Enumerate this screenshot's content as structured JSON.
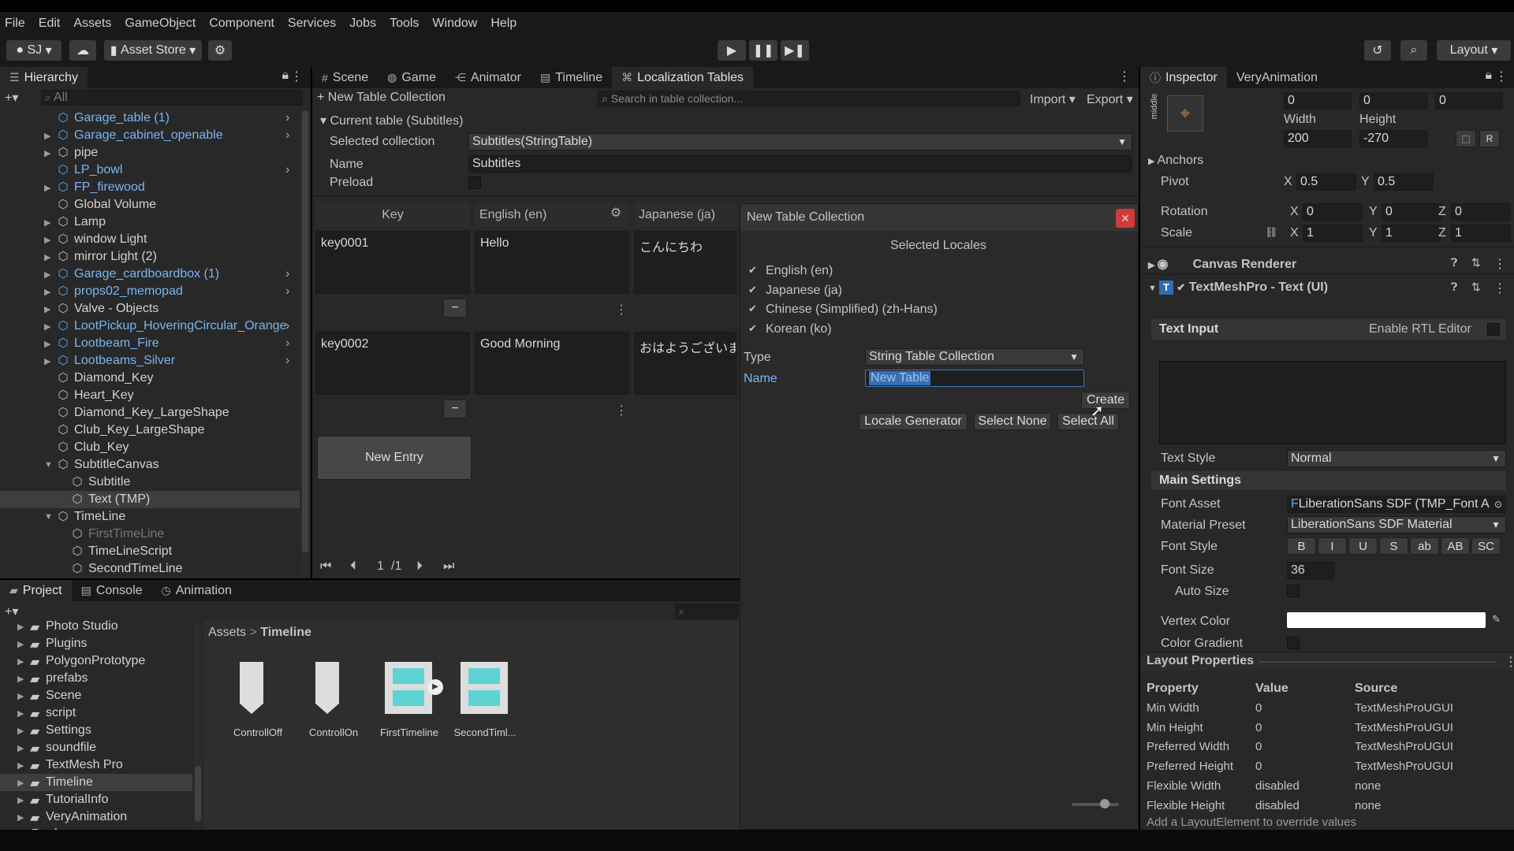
{
  "menu": [
    "File",
    "Edit",
    "Assets",
    "GameObject",
    "Component",
    "Services",
    "Jobs",
    "Tools",
    "Window",
    "Help"
  ],
  "toolbar": {
    "account": "SJ",
    "asset_store": "Asset Store",
    "layout": "Layout"
  },
  "hierarchy": {
    "tab": "Hierarchy",
    "search_placeholder": "All",
    "items": [
      {
        "label": "Garage_table (1)",
        "blue": true,
        "indent": 0,
        "exp": false,
        "chev": true
      },
      {
        "label": "Garage_cabinet_openable",
        "blue": true,
        "indent": 0,
        "exp": true,
        "chev": true
      },
      {
        "label": "pipe",
        "blue": false,
        "indent": 0,
        "exp": true,
        "chev": false
      },
      {
        "label": "LP_bowl",
        "blue": true,
        "indent": 0,
        "exp": false,
        "chev": true
      },
      {
        "label": "FP_firewood",
        "blue": true,
        "indent": 0,
        "exp": true,
        "chev": false
      },
      {
        "label": "Global Volume",
        "blue": false,
        "indent": 0,
        "exp": false,
        "chev": false
      },
      {
        "label": "Lamp",
        "blue": false,
        "indent": 0,
        "exp": true,
        "chev": false
      },
      {
        "label": "window Light",
        "blue": false,
        "indent": 0,
        "exp": true,
        "chev": false
      },
      {
        "label": "mirror Light (2)",
        "blue": false,
        "indent": 0,
        "exp": true,
        "chev": false
      },
      {
        "label": "Garage_cardboardbox (1)",
        "blue": true,
        "indent": 0,
        "exp": true,
        "chev": true
      },
      {
        "label": "props02_memopad",
        "blue": true,
        "indent": 0,
        "exp": true,
        "chev": true
      },
      {
        "label": "Valve - Objects",
        "blue": false,
        "indent": 0,
        "exp": true,
        "chev": false
      },
      {
        "label": "LootPickup_HoveringCircular_Orange",
        "blue": true,
        "indent": 0,
        "exp": true,
        "chev": true
      },
      {
        "label": "Lootbeam_Fire",
        "blue": true,
        "indent": 0,
        "exp": true,
        "chev": true
      },
      {
        "label": "Lootbeams_Silver",
        "blue": true,
        "indent": 0,
        "exp": true,
        "chev": true
      },
      {
        "label": "Diamond_Key",
        "blue": false,
        "indent": 0,
        "exp": false,
        "chev": false
      },
      {
        "label": "Heart_Key",
        "blue": false,
        "indent": 0,
        "exp": false,
        "chev": false
      },
      {
        "label": "Diamond_Key_LargeShape",
        "blue": false,
        "indent": 0,
        "exp": false,
        "chev": false
      },
      {
        "label": "Club_Key_LargeShape",
        "blue": false,
        "indent": 0,
        "exp": false,
        "chev": false
      },
      {
        "label": "Club_Key",
        "blue": false,
        "indent": 0,
        "exp": false,
        "chev": false
      },
      {
        "label": "SubtitleCanvas",
        "blue": false,
        "indent": 0,
        "exp": true,
        "open": true,
        "chev": false
      },
      {
        "label": "Subtitle",
        "blue": false,
        "indent": 1,
        "exp": false,
        "chev": false
      },
      {
        "label": "Text (TMP)",
        "blue": false,
        "indent": 1,
        "exp": false,
        "chev": false,
        "selected": true
      },
      {
        "label": "TimeLine",
        "blue": false,
        "indent": 0,
        "exp": true,
        "open": true,
        "chev": false
      },
      {
        "label": "FirstTimeLine",
        "blue": false,
        "indent": 1,
        "exp": false,
        "chev": false,
        "dim": true
      },
      {
        "label": "TimeLineScript",
        "blue": false,
        "indent": 1,
        "exp": false,
        "chev": false
      },
      {
        "label": "SecondTimeLine",
        "blue": false,
        "indent": 1,
        "exp": false,
        "chev": false
      }
    ]
  },
  "center_tabs": [
    "Scene",
    "Game",
    "Animator",
    "Timeline",
    "Localization Tables"
  ],
  "loc": {
    "new_collection": "New Table Collection",
    "search_placeholder": "Search in table collection...",
    "import": "Import",
    "export": "Export",
    "current_table": "Current table (Subtitles)",
    "selected_collection_label": "Selected collection",
    "selected_collection_value": "Subtitles(StringTable)",
    "name_label": "Name",
    "name_value": "Subtitles",
    "preload_label": "Preload",
    "col_key": "Key",
    "col_en": "English (en)",
    "col_ja": "Japanese (ja)",
    "rows": [
      {
        "key": "key0001",
        "en": "Hello",
        "ja": "こんにちわ"
      },
      {
        "key": "key0002",
        "en": "Good Morning",
        "ja": "おはようございます。"
      }
    ],
    "new_entry": "New Entry",
    "page": "1",
    "page_total": "/1"
  },
  "dialog": {
    "title": "New Table Collection",
    "selected_locales": "Selected Locales",
    "locales": [
      "English (en)",
      "Japanese (ja)",
      "Chinese (Simplified) (zh-Hans)",
      "Korean (ko)"
    ],
    "type_label": "Type",
    "type_value": "String Table Collection",
    "name_label": "Name",
    "name_value": "New Table",
    "create": "Create",
    "locale_generator": "Locale Generator",
    "select_none": "Select None",
    "select_all": "Select All"
  },
  "project": {
    "tabs": [
      "Project",
      "Console",
      "Animation"
    ],
    "folders": [
      "Photo Studio",
      "Plugins",
      "PolygonPrototype",
      "prefabs",
      "Scene",
      "script",
      "Settings",
      "soundfile",
      "TextMesh Pro",
      "Timeline",
      "TutorialInfo",
      "VeryAnimation"
    ],
    "packages": "Packages",
    "breadcrumb_root": "Assets",
    "breadcrumb_current": "Timeline",
    "assets": [
      "ControllOff",
      "ControllOn",
      "FirstTimeline",
      "SecondTiml..."
    ]
  },
  "inspector": {
    "tabs": [
      "Inspector",
      "VeryAnimation"
    ],
    "anchor_preset": "middle",
    "pos_values": [
      "0",
      "0",
      "0"
    ],
    "width_label": "Width",
    "height_label": "Height",
    "width": "200",
    "height": "-270",
    "anchors": "Anchors",
    "pivot_label": "Pivot",
    "pivot_x": "0.5",
    "pivot_y": "0.5",
    "rotation_label": "Rotation",
    "rotation": [
      "0",
      "0",
      "0"
    ],
    "scale_label": "Scale",
    "scale": [
      "1",
      "1",
      "1"
    ],
    "x": "X",
    "y": "Y",
    "z": "Z",
    "canvas_renderer": "Canvas Renderer",
    "tmp_component": "TextMeshPro - Text (UI)",
    "text_input": "Text Input",
    "enable_rtl": "Enable RTL Editor",
    "text_style_label": "Text Style",
    "text_style": "Normal",
    "main_settings": "Main Settings",
    "font_asset_label": "Font Asset",
    "font_asset": "LiberationSans SDF (TMP_Font A",
    "material_preset_label": "Material Preset",
    "material_preset": "LiberationSans SDF Material",
    "font_style_label": "Font Style",
    "font_styles": [
      "B",
      "I",
      "U",
      "S",
      "ab",
      "AB",
      "SC"
    ],
    "font_size_label": "Font Size",
    "font_size": "36",
    "auto_size": "Auto Size",
    "vertex_color": "Vertex Color",
    "color_gradient": "Color Gradient",
    "layout_props": "Layout Properties",
    "lp_headers": [
      "Property",
      "Value",
      "Source"
    ],
    "lp_rows": [
      [
        "Min Width",
        "0",
        "TextMeshProUGUI"
      ],
      [
        "Min Height",
        "0",
        "TextMeshProUGUI"
      ],
      [
        "Preferred Width",
        "0",
        "TextMeshProUGUI"
      ],
      [
        "Preferred Height",
        "0",
        "TextMeshProUGUI"
      ],
      [
        "Flexible Width",
        "disabled",
        "none"
      ],
      [
        "Flexible Height",
        "disabled",
        "none"
      ]
    ],
    "footer": "Add a LayoutElement to override values"
  }
}
